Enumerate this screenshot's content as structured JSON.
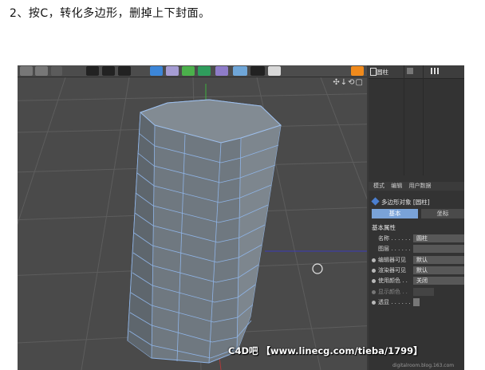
{
  "caption": "2、按C，转化多边形，删掉上下封面。",
  "object_manager": {
    "object_name": "圆柱"
  },
  "attributes": {
    "tabs": [
      "模式",
      "编辑",
      "用户数据"
    ],
    "object_title": "多边形对象 [圆柱]",
    "tab_basic": "基本",
    "tab_coord": "坐标",
    "section_title": "基本属性",
    "rows": [
      {
        "label": "名称 . . . . . .",
        "value": "圆柱"
      },
      {
        "label": "图层 . . . . . .",
        "value": ""
      },
      {
        "label": "编辑器可见",
        "value": "默认"
      },
      {
        "label": "渲染器可见",
        "value": "默认"
      },
      {
        "label": "使用颜色 . .",
        "value": "关闭"
      },
      {
        "label": "显示颜色 . .",
        "value": ""
      },
      {
        "label": "透显 . . . . . .",
        "value": ""
      }
    ]
  },
  "viewport": {
    "tools": "✣↓⟲▢"
  },
  "watermark": "C4D吧 【www.linecg.com/tieba/1799】",
  "sub_watermark": "digitalroom.blog.163.com",
  "colors": {
    "accent_blue": "#7aa3d8",
    "mesh_edge": "#8fb4e6",
    "model_surface": "#6f7880"
  }
}
